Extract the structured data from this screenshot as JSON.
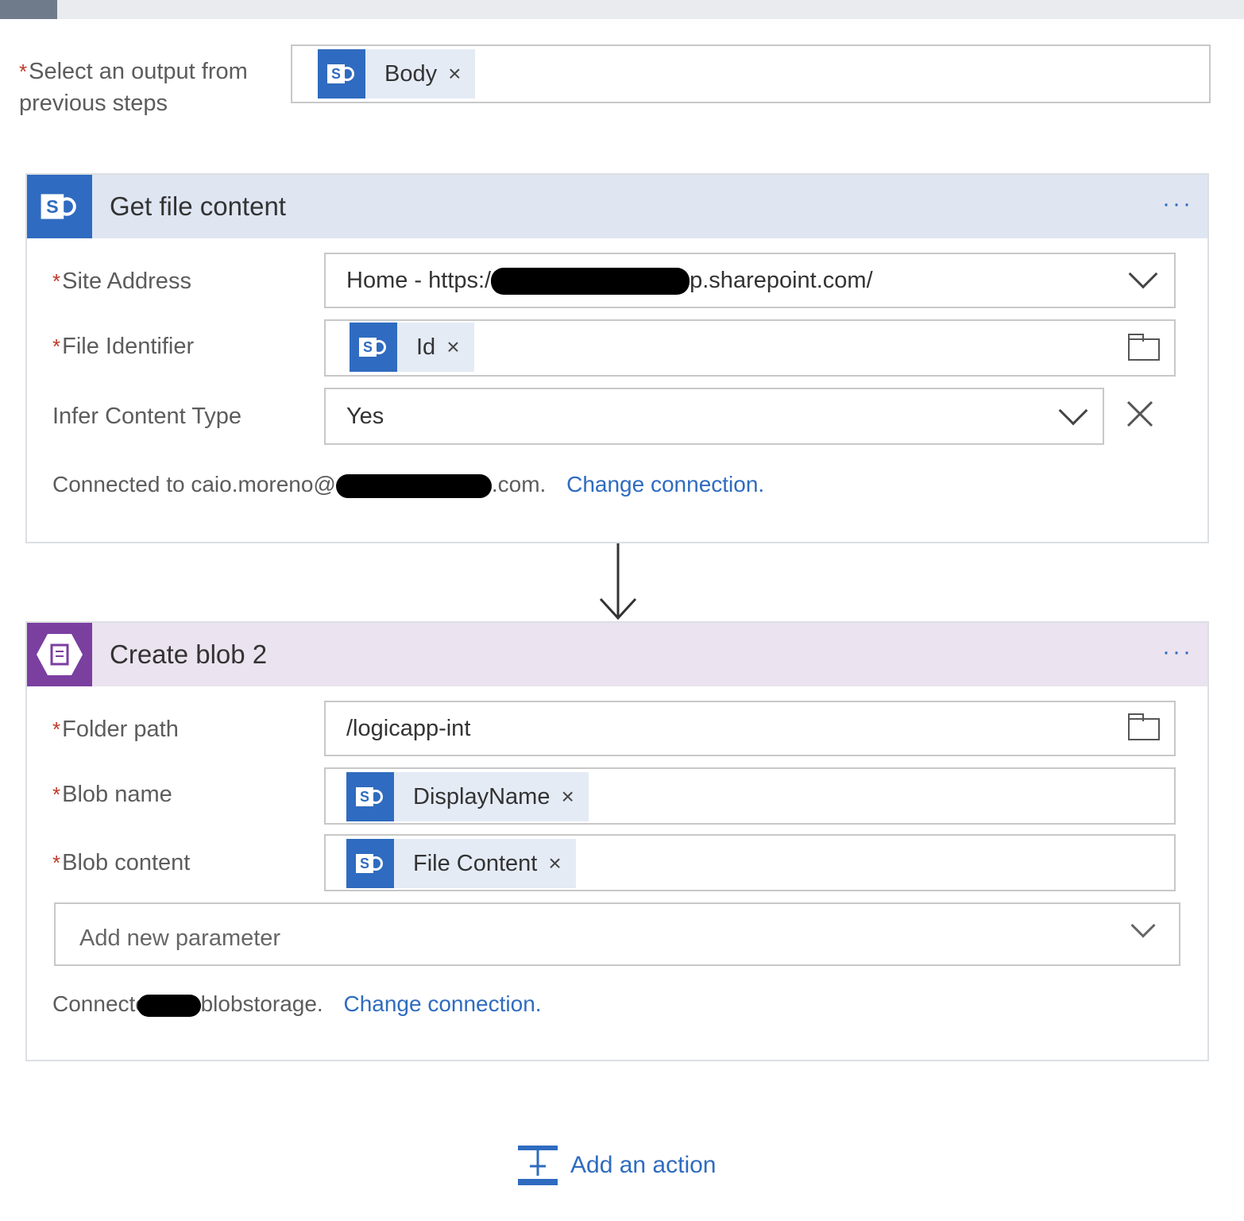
{
  "foreach": {
    "output_label": "Select an output from previous steps",
    "required_mark": "*",
    "token_body": "Body",
    "token_remove": "×"
  },
  "get_file": {
    "title": "Get file content",
    "more": "···",
    "site_label": "Site Address",
    "site_value_prefix": "Home - https:/",
    "site_value_suffix": "p.sharepoint.com/",
    "file_label": "File Identifier",
    "file_token": "Id",
    "infer_label": "Infer Content Type",
    "infer_value": "Yes",
    "connected_prefix": "Connected to caio.moreno@",
    "connected_suffix": ".com.",
    "change_connection": "Change connection."
  },
  "create_blob": {
    "title": "Create blob 2",
    "more": "···",
    "folder_label": "Folder path",
    "folder_value": "/logicapp-int",
    "blob_name_label": "Blob name",
    "blob_name_token": "DisplayName",
    "blob_content_label": "Blob content",
    "blob_content_token": "File Content",
    "add_param_placeholder": "Add new parameter",
    "connected_prefix": "Connected to",
    "connected_suffix": "blobstorage.",
    "change_connection": "Change connection."
  },
  "footer": {
    "add_action": "Add an action"
  },
  "colors": {
    "sharepoint_blue": "#2f6bc0",
    "blob_purple": "#7b3fa0",
    "sp_header_bg": "#dfe6f2",
    "blob_header_bg": "#ebe3ef",
    "link": "#2f6bc0",
    "required": "#c0392b"
  },
  "icons": {
    "sharepoint": "sharepoint-icon",
    "blob": "blob-storage-icon",
    "dropdown": "chevron-down-icon",
    "folder": "folder-icon",
    "clear": "close-icon",
    "arrow": "arrow-down-icon",
    "add_action": "add-action-icon"
  }
}
